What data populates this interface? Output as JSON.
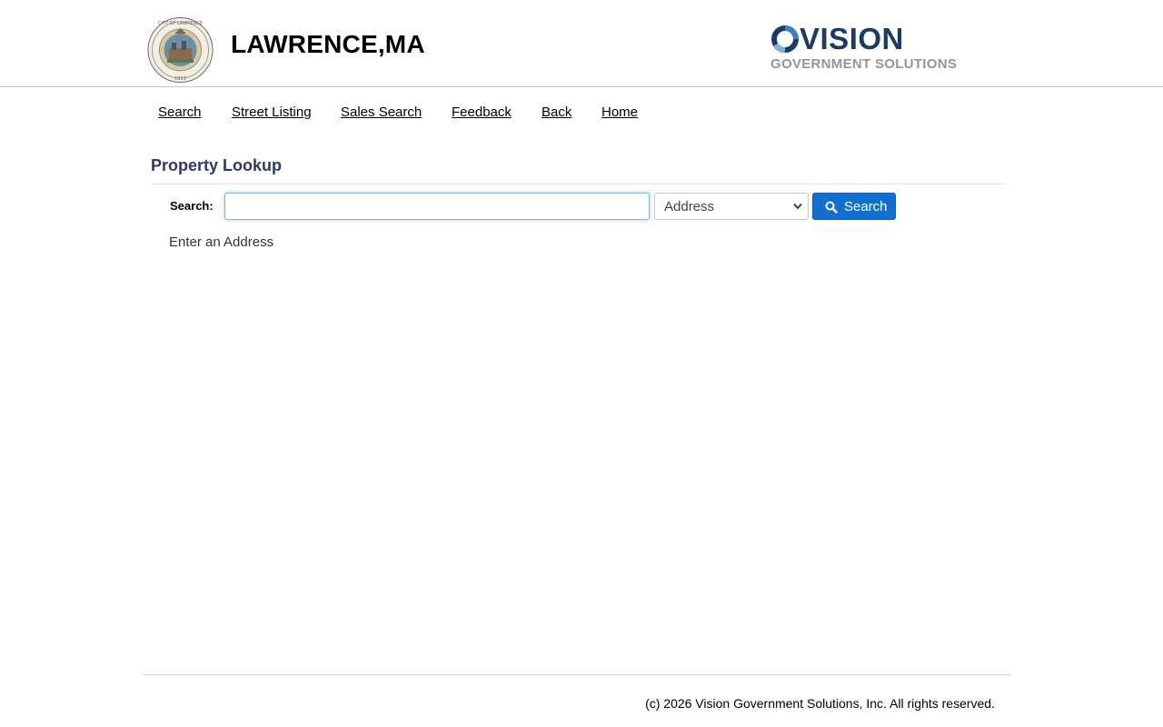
{
  "header": {
    "town_name": "LAWRENCE,MA",
    "seal_icon": "city-seal-icon",
    "vendor_logo": {
      "word": "VISION",
      "subtitle": "GOVERNMENT SOLUTIONS",
      "mark_icon": "vision-ring-icon",
      "colors": {
        "word": "#1d3a66",
        "subtitle": "#8f969c"
      }
    }
  },
  "nav": {
    "items": [
      {
        "label": "Search"
      },
      {
        "label": "Street Listing"
      },
      {
        "label": "Sales Search"
      },
      {
        "label": "Feedback"
      },
      {
        "label": "Back"
      },
      {
        "label": "Home"
      }
    ]
  },
  "lookup": {
    "title": "Property Lookup",
    "search_label": "Search:",
    "search_value": "",
    "search_placeholder": "",
    "type_selected": "Address",
    "type_options": [
      "Address"
    ],
    "button_label": "Search",
    "button_icon": "magnifier-icon",
    "hint": "Enter an Address"
  },
  "footer": {
    "copyright": "(c) 2026 Vision Government Solutions, Inc. All rights reserved."
  },
  "colors": {
    "accent": "#1170cf",
    "title": "#2e3a63",
    "input_focus": "#7fb3e0"
  }
}
